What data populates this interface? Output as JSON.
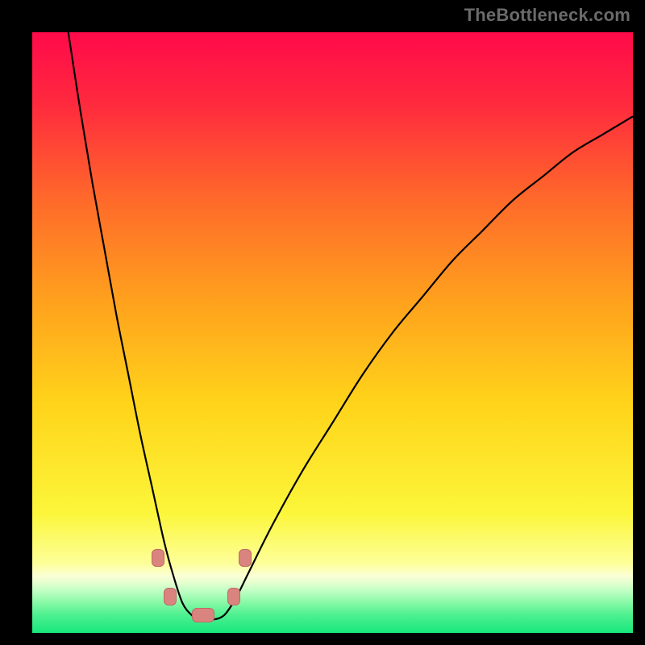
{
  "watermark": "TheBottleneck.com",
  "chart_data": {
    "type": "line",
    "title": "",
    "xlabel": "",
    "ylabel": "",
    "xlim": [
      0,
      100
    ],
    "ylim": [
      0,
      100
    ],
    "grid": false,
    "legend": false,
    "background_gradient": {
      "stops": [
        {
          "pos": 0.0,
          "color": "#ff0a4a"
        },
        {
          "pos": 0.12,
          "color": "#ff2a3e"
        },
        {
          "pos": 0.28,
          "color": "#ff6a2a"
        },
        {
          "pos": 0.45,
          "color": "#ffa21d"
        },
        {
          "pos": 0.62,
          "color": "#ffd41a"
        },
        {
          "pos": 0.8,
          "color": "#fcf63a"
        },
        {
          "pos": 0.885,
          "color": "#fdff9a"
        },
        {
          "pos": 0.905,
          "color": "#fbffd6"
        },
        {
          "pos": 0.915,
          "color": "#e8ffd0"
        },
        {
          "pos": 0.93,
          "color": "#c0ffc4"
        },
        {
          "pos": 0.95,
          "color": "#86f9a6"
        },
        {
          "pos": 0.97,
          "color": "#4ef090"
        },
        {
          "pos": 1.0,
          "color": "#18e77c"
        }
      ]
    },
    "series": [
      {
        "name": "bottleneck-curve",
        "color": "#000000",
        "x": [
          6,
          8,
          10,
          12,
          14,
          16,
          18,
          20,
          22,
          23.5,
          25,
          26.5,
          28,
          30,
          32,
          34,
          36,
          40,
          45,
          50,
          55,
          60,
          65,
          70,
          75,
          80,
          85,
          90,
          95,
          100
        ],
        "y": [
          100,
          87,
          75,
          64,
          53,
          43,
          33,
          24,
          15,
          9.5,
          5,
          3,
          2.2,
          2.2,
          3,
          6,
          10,
          18,
          27,
          35,
          43,
          50,
          56,
          62,
          67,
          72,
          76,
          80,
          83,
          86
        ]
      }
    ],
    "markers": [
      {
        "x": 21.0,
        "y": 12.5,
        "w": 14,
        "h": 20
      },
      {
        "x": 23.0,
        "y": 6.0,
        "w": 14,
        "h": 20
      },
      {
        "x": 28.5,
        "y": 3.0,
        "w": 26,
        "h": 16
      },
      {
        "x": 33.5,
        "y": 6.0,
        "w": 14,
        "h": 20
      },
      {
        "x": 35.5,
        "y": 12.5,
        "w": 14,
        "h": 20
      }
    ]
  }
}
